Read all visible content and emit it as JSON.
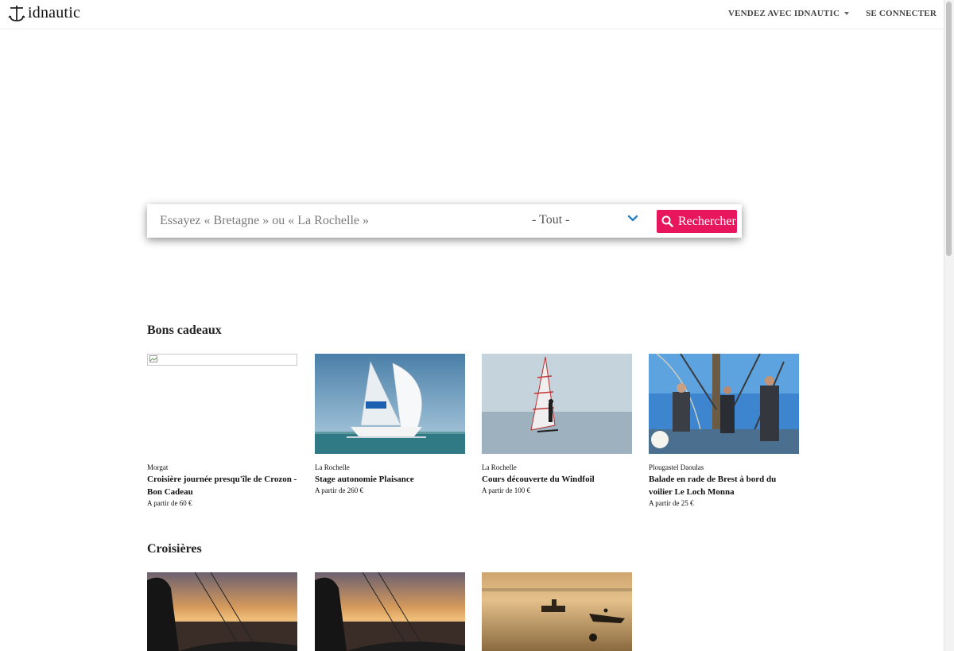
{
  "header": {
    "logo_text": "idnautic",
    "nav": {
      "sell_label": "VENDEZ AVEC IDNAUTIC",
      "login_label": "SE CONNECTER"
    }
  },
  "search": {
    "placeholder": "Essayez « Bretagne » ou « La Rochelle »",
    "category_value": "- Tout -",
    "button_label": "Rechercher"
  },
  "sections": [
    {
      "title": "Bons cadeaux",
      "cards": [
        {
          "location": "Morgat",
          "title": "Croisière journée presqu'île de Crozon - Bon Cadeau",
          "price": "A partir de 60 €"
        },
        {
          "location": "La Rochelle",
          "title": "Stage autonomie Plaisance",
          "price": "A partir de 260 €"
        },
        {
          "location": "La Rochelle",
          "title": "Cours découverte du Windfoil",
          "price": "A partir de 100 €"
        },
        {
          "location": "Plougastel Daoulas",
          "title": "Balade en rade de Brest à bord du voilier Le Loch Monna",
          "price": "A partir de 25 €"
        }
      ]
    },
    {
      "title": "Croisières"
    }
  ],
  "colors": {
    "accent": "#e8175d",
    "chevron": "#2a7fc9"
  }
}
